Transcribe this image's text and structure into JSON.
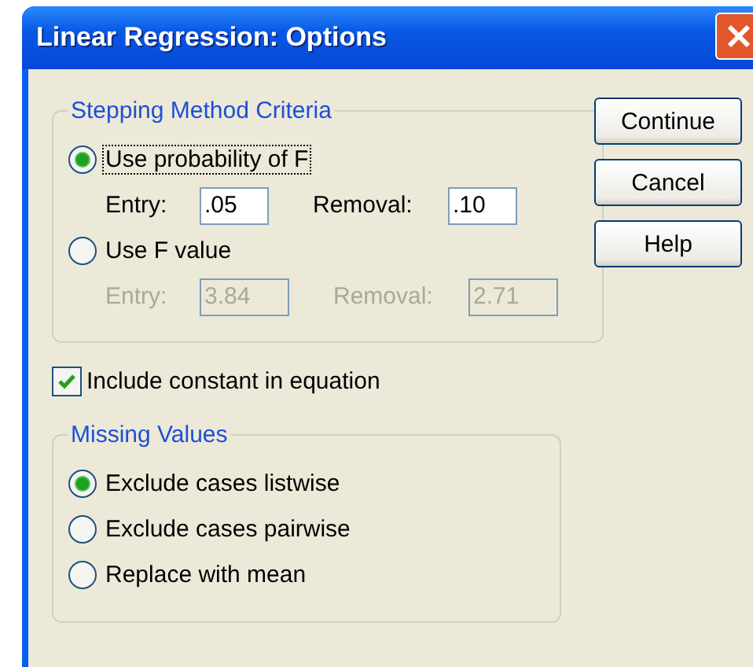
{
  "window": {
    "title": "Linear Regression: Options"
  },
  "stepping_method_criteria": {
    "title": "Stepping Method Criteria",
    "options": [
      {
        "label": "Use probability of F",
        "selected": true,
        "focused": true,
        "fields": [
          {
            "label": "Entry:",
            "value": ".05",
            "disabled": false
          },
          {
            "label": "Removal:",
            "value": ".10",
            "disabled": false
          }
        ]
      },
      {
        "label": "Use F value",
        "selected": false,
        "focused": false,
        "fields": [
          {
            "label": "Entry:",
            "value": "3.84",
            "disabled": true
          },
          {
            "label": "Removal:",
            "value": "2.71",
            "disabled": true
          }
        ]
      }
    ]
  },
  "include_constant": {
    "label": "Include constant in equation",
    "checked": true
  },
  "missing_values": {
    "title": "Missing Values",
    "options": [
      {
        "label": "Exclude cases listwise",
        "selected": true
      },
      {
        "label": "Exclude cases pairwise",
        "selected": false
      },
      {
        "label": "Replace with mean",
        "selected": false
      }
    ]
  },
  "buttons": [
    "Continue",
    "Cancel",
    "Help"
  ]
}
